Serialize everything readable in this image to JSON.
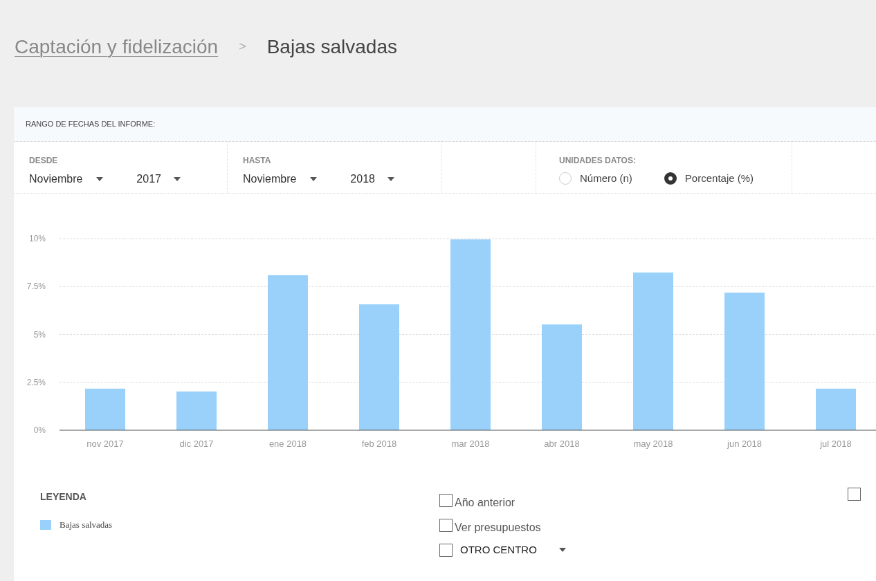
{
  "breadcrumb": {
    "parent": "Captación y fidelización",
    "separator": ">",
    "current": "Bajas salvadas"
  },
  "filters": {
    "title": "RANGO DE FECHAS DEL INFORME:",
    "from": {
      "label": "DESDE",
      "month": "Noviembre",
      "year": "2017"
    },
    "to": {
      "label": "HASTA",
      "month": "Noviembre",
      "year": "2018"
    },
    "units": {
      "label": "UNIDADES DATOS:",
      "options": [
        {
          "label": "Número (n)",
          "selected": false
        },
        {
          "label": "Porcentaje (%)",
          "selected": true
        }
      ]
    }
  },
  "chart": {
    "chart_data": {
      "type": "bar",
      "categories": [
        "nov 2017",
        "dic 2017",
        "ene 2018",
        "feb 2018",
        "mar 2018",
        "abr 2018",
        "may 2018",
        "jun 2018",
        "jul 2018"
      ],
      "series": [
        {
          "name": "Bajas salvadas",
          "color": "#99d1fb",
          "values": [
            2.17,
            2.02,
            8.09,
            6.57,
            9.96,
            5.52,
            8.23,
            7.18,
            2.17
          ]
        }
      ],
      "ylim": [
        0,
        10
      ],
      "grid": true,
      "yticks": [
        {
          "value": 0,
          "label": "0%"
        },
        {
          "value": 2.5,
          "label": "2.5%"
        },
        {
          "value": 5,
          "label": "5%"
        },
        {
          "value": 7.5,
          "label": "7.5%"
        },
        {
          "value": 10,
          "label": "10%"
        }
      ]
    }
  },
  "legend": {
    "title": "LEYENDA"
  },
  "options": [
    {
      "kind": "checkbox",
      "label": "Año anterior",
      "checked": false
    },
    {
      "kind": "checkbox",
      "label": "Ver presupuestos",
      "checked": false
    },
    {
      "kind": "select",
      "label": "OTRO CENTRO",
      "checked": false
    }
  ],
  "extra_option": {
    "checked": false
  }
}
